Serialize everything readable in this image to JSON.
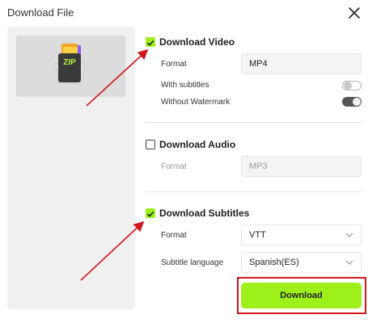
{
  "dialog": {
    "title": "Download File"
  },
  "preview": {
    "zip_label": "ZIP"
  },
  "video": {
    "title": "Download Video",
    "checked": true,
    "format_label": "Format",
    "format_value": "MP4",
    "subtitles_label": "With subtitles",
    "subtitles_on": false,
    "watermark_label": "Without Watermark",
    "watermark_on": true
  },
  "audio": {
    "title": "Download Audio",
    "checked": false,
    "format_label": "Format",
    "format_value": "MP3"
  },
  "subtitles": {
    "title": "Download Subtitles",
    "checked": true,
    "format_label": "Format",
    "format_value": "VTT",
    "language_label": "Subtitle language",
    "language_value": "Spanish(ES)"
  },
  "actions": {
    "download_label": "Download"
  },
  "colors": {
    "accent": "#9ef01a",
    "highlight": "#d1171b"
  },
  "icons": [
    "close-icon",
    "check-icon",
    "chevron-down-icon",
    "zip-file-icon",
    "arrow-annotation"
  ]
}
